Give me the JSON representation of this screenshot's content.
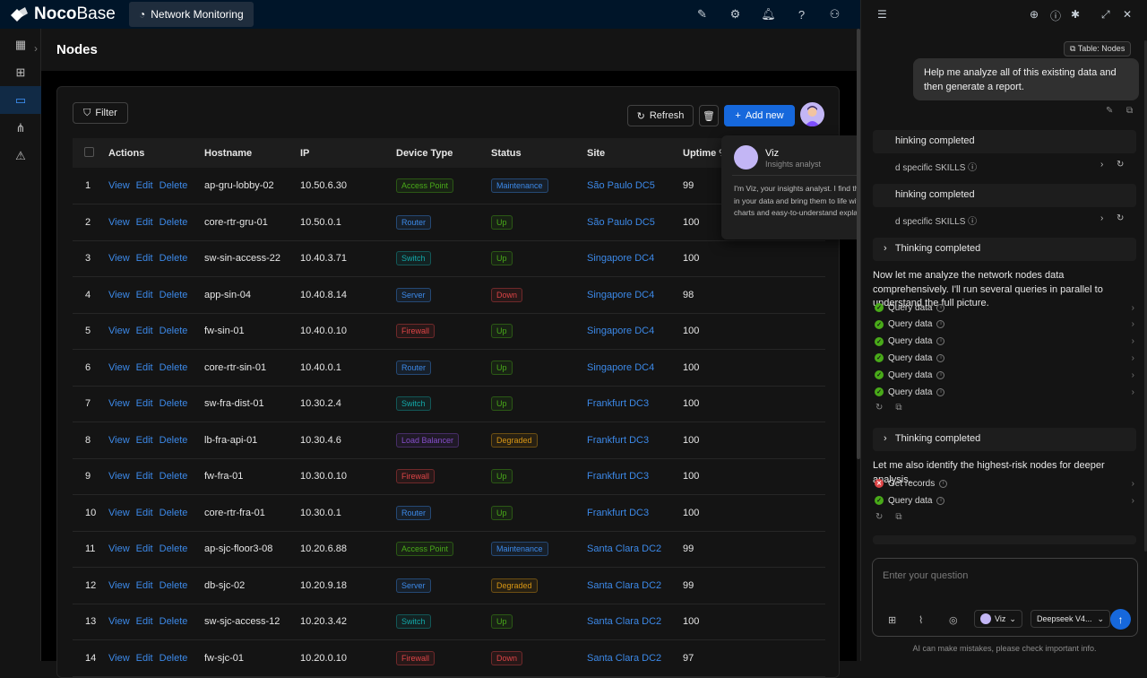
{
  "app": {
    "logo_bold": "Noco",
    "logo_light": "Base",
    "active_tab": "Network Monitoring"
  },
  "page": {
    "title": "Nodes"
  },
  "toolbar": {
    "filter": "Filter",
    "refresh": "Refresh",
    "add_new": "Add new"
  },
  "table": {
    "headers": {
      "actions": "Actions",
      "hostname": "Hostname",
      "ip": "IP",
      "device_type": "Device Type",
      "status": "Status",
      "site": "Site",
      "uptime": "Uptime %"
    },
    "action_labels": {
      "view": "View",
      "edit": "Edit",
      "delete": "Delete"
    },
    "rows": [
      {
        "n": "1",
        "hostname": "ap-gru-lobby-02",
        "ip": "10.50.6.30",
        "type": "Access Point",
        "status": "Maintenance",
        "site": "São Paulo DC5",
        "uptime": "99"
      },
      {
        "n": "2",
        "hostname": "core-rtr-gru-01",
        "ip": "10.50.0.1",
        "type": "Router",
        "status": "Up",
        "site": "São Paulo DC5",
        "uptime": "100"
      },
      {
        "n": "3",
        "hostname": "sw-sin-access-22",
        "ip": "10.40.3.71",
        "type": "Switch",
        "status": "Up",
        "site": "Singapore DC4",
        "uptime": "100"
      },
      {
        "n": "4",
        "hostname": "app-sin-04",
        "ip": "10.40.8.14",
        "type": "Server",
        "status": "Down",
        "site": "Singapore DC4",
        "uptime": "98"
      },
      {
        "n": "5",
        "hostname": "fw-sin-01",
        "ip": "10.40.0.10",
        "type": "Firewall",
        "status": "Up",
        "site": "Singapore DC4",
        "uptime": "100"
      },
      {
        "n": "6",
        "hostname": "core-rtr-sin-01",
        "ip": "10.40.0.1",
        "type": "Router",
        "status": "Up",
        "site": "Singapore DC4",
        "uptime": "100"
      },
      {
        "n": "7",
        "hostname": "sw-fra-dist-01",
        "ip": "10.30.2.4",
        "type": "Switch",
        "status": "Up",
        "site": "Frankfurt DC3",
        "uptime": "100"
      },
      {
        "n": "8",
        "hostname": "lb-fra-api-01",
        "ip": "10.30.4.6",
        "type": "Load Balancer",
        "status": "Degraded",
        "site": "Frankfurt DC3",
        "uptime": "100"
      },
      {
        "n": "9",
        "hostname": "fw-fra-01",
        "ip": "10.30.0.10",
        "type": "Firewall",
        "status": "Up",
        "site": "Frankfurt DC3",
        "uptime": "100"
      },
      {
        "n": "10",
        "hostname": "core-rtr-fra-01",
        "ip": "10.30.0.1",
        "type": "Router",
        "status": "Up",
        "site": "Frankfurt DC3",
        "uptime": "100"
      },
      {
        "n": "11",
        "hostname": "ap-sjc-floor3-08",
        "ip": "10.20.6.88",
        "type": "Access Point",
        "status": "Maintenance",
        "site": "Santa Clara DC2",
        "uptime": "99"
      },
      {
        "n": "12",
        "hostname": "db-sjc-02",
        "ip": "10.20.9.18",
        "type": "Server",
        "status": "Degraded",
        "site": "Santa Clara DC2",
        "uptime": "99"
      },
      {
        "n": "13",
        "hostname": "sw-sjc-access-12",
        "ip": "10.20.3.42",
        "type": "Switch",
        "status": "Up",
        "site": "Santa Clara DC2",
        "uptime": "100"
      },
      {
        "n": "14",
        "hostname": "fw-sjc-01",
        "ip": "10.20.0.10",
        "type": "Firewall",
        "status": "Down",
        "site": "Santa Clara DC2",
        "uptime": "97"
      }
    ]
  },
  "type_colors": {
    "Access Point": "#49aa19",
    "Router": "#3c89e8",
    "Switch": "#13a8a8",
    "Server": "#3c89e8",
    "Firewall": "#dc4446",
    "Load Balancer": "#854eca"
  },
  "status_colors": {
    "Maintenance": "#3c89e8",
    "Up": "#49aa19",
    "Down": "#dc4446",
    "Degraded": "#d89614"
  },
  "assistant_popup": {
    "name": "Viz",
    "role": "Insights analyst",
    "description": "I'm Viz, your insights analyst. I find the stories in your data and bring them to life with clear charts and easy-to-understand explanations."
  },
  "chat": {
    "context_badge": "Table: Nodes",
    "user_message": "Help me analyze all of this existing data and then generate a report.",
    "thinking_label": "Thinking completed",
    "thinking_blocks_visible": [
      "hinking completed",
      "hinking completed"
    ],
    "skills_label": "d specific SKILLS",
    "text1": "Now let me analyze the network nodes data comprehensively. I'll run several queries in parallel to understand the full picture.",
    "query_label": "Query data",
    "text2": "Let me also identify the highest-risk nodes for deeper analysis.",
    "get_records_label": "Get records",
    "input_placeholder": "Enter your question",
    "assistant_selector": "Viz",
    "model_selector": "Deepseek V4...",
    "disclaimer": "AI can make mistakes, please check important info."
  }
}
